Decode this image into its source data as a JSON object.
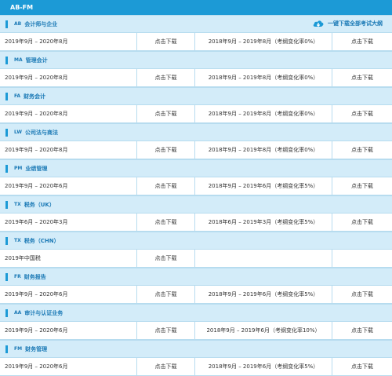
{
  "header": {
    "title": "AB-FM"
  },
  "download_all_label": "一键下载全部考试大纲",
  "sections": [
    {
      "code": "AB",
      "name": "会计师与企业",
      "period": "2019年9月 – 2020年8月",
      "download": "点击下载",
      "prev_period": "2018年9月 – 2019年8月（考纲变化率0%）",
      "prev_download": "点击下载"
    },
    {
      "code": "MA",
      "name": "管理会计",
      "period": "2019年9月 – 2020年8月",
      "download": "点击下载",
      "prev_period": "2018年9月 – 2019年8月（考纲变化率0%）",
      "prev_download": "点击下载"
    },
    {
      "code": "FA",
      "name": "财务会计",
      "period": "2019年9月 – 2020年8月",
      "download": "点击下载",
      "prev_period": "2018年9月 – 2019年8月（考纲变化率0%）",
      "prev_download": "点击下载"
    },
    {
      "code": "LW",
      "name": "公司法与商法",
      "period": "2019年9月 – 2020年8月",
      "download": "点击下载",
      "prev_period": "2018年9月 – 2019年8月（考纲变化率0%）",
      "prev_download": "点击下载"
    },
    {
      "code": "PM",
      "name": "业绩管理",
      "period": "2019年9月 – 2020年6月",
      "download": "点击下载",
      "prev_period": "2018年9月 – 2019年6月（考纲变化率5%）",
      "prev_download": "点击下载"
    },
    {
      "code": "TX",
      "name": "税务（UK）",
      "period": "2019年6月 – 2020年3月",
      "download": "点击下载",
      "prev_period": "2018年6月 – 2019年3月（考纲变化率5%）",
      "prev_download": "点击下载"
    },
    {
      "code": "TX",
      "name": "税务（CHN）",
      "period": "2019年中国税",
      "download": "点击下载",
      "prev_period": "",
      "prev_download": ""
    },
    {
      "code": "FR",
      "name": "财务报告",
      "period": "2019年9月 – 2020年6月",
      "download": "点击下载",
      "prev_period": "2018年9月 – 2019年6月（考纲变化率5%）",
      "prev_download": "点击下载"
    },
    {
      "code": "AA",
      "name": "审计与认证业务",
      "period": "2019年9月 – 2020年6月",
      "download": "点击下载",
      "prev_period": "2018年9月 – 2019年6月（考纲变化率10%）",
      "prev_download": "点击下载"
    },
    {
      "code": "FM",
      "name": "财务管理",
      "period": "2019年9月 – 2020年6月",
      "download": "点击下载",
      "prev_period": "2018年9月 – 2019年6月（考纲变化率5%）",
      "prev_download": "点击下载"
    }
  ]
}
